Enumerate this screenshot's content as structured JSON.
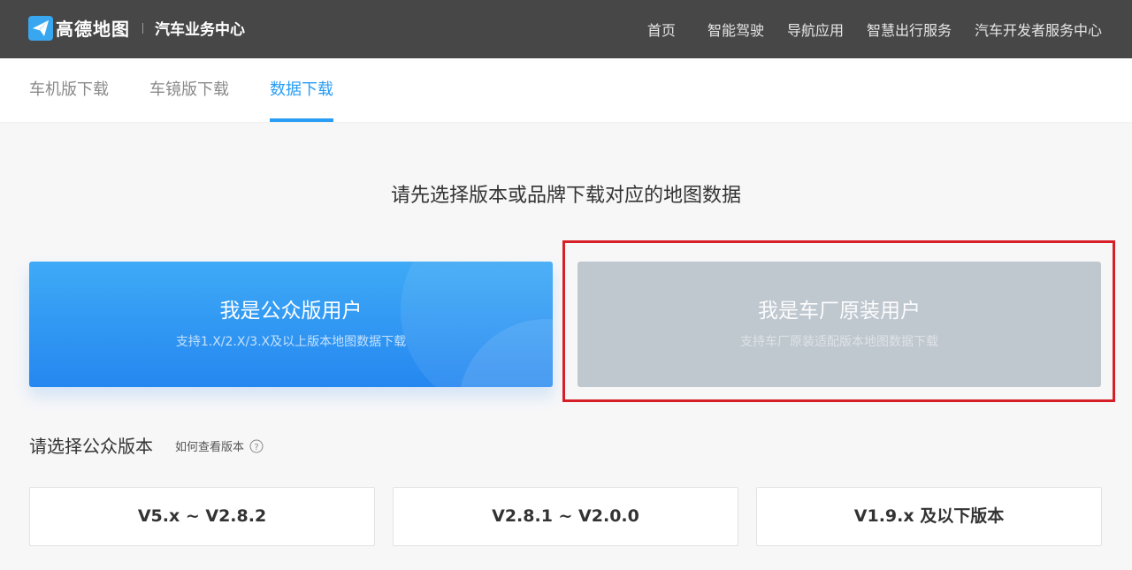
{
  "header": {
    "logo_text": "高德地图",
    "logo_subtitle": "汽车业务中心",
    "nav": [
      "首页",
      "智能驾驶",
      "导航应用",
      "智慧出行服务",
      "汽车开发者服务中心"
    ]
  },
  "tabs": [
    {
      "label": "车机版下载",
      "active": false
    },
    {
      "label": "车镜版下载",
      "active": false
    },
    {
      "label": "数据下载",
      "active": true
    }
  ],
  "main": {
    "prompt": "请先选择版本或品牌下载对应的地图数据",
    "cards": [
      {
        "title": "我是公众版用户",
        "desc": "支持1.X/2.X/3.X及以上版本地图数据下载"
      },
      {
        "title": "我是车厂原装用户",
        "desc": "支持车厂原装适配版本地图数据下载"
      }
    ],
    "section_title": "请选择公众版本",
    "help_link": "如何查看版本",
    "versions": [
      "V5.x ~ V2.8.2",
      "V2.8.1 ~ V2.0.0",
      "V1.9.x 及以下版本"
    ]
  },
  "colors": {
    "topbar": "#474747",
    "accent": "#2a9df4",
    "highlight": "#d61f26",
    "card_public": "#2f95f2",
    "card_oem": "#bfc7cf"
  }
}
